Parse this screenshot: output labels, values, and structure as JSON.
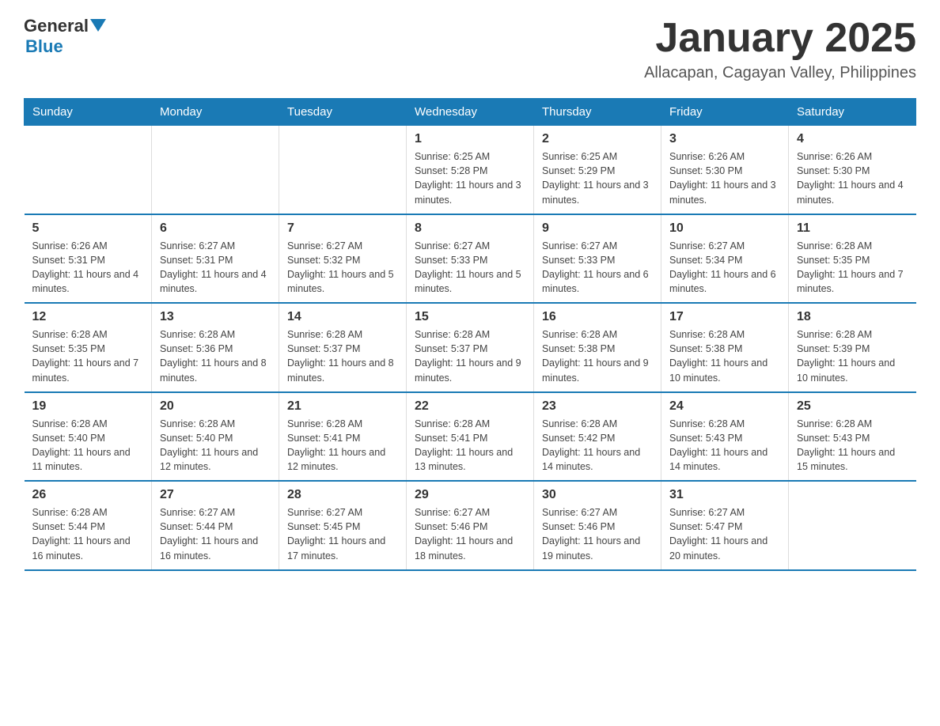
{
  "header": {
    "logo_general": "General",
    "logo_blue": "Blue",
    "month_title": "January 2025",
    "location": "Allacapan, Cagayan Valley, Philippines"
  },
  "weekdays": [
    "Sunday",
    "Monday",
    "Tuesday",
    "Wednesday",
    "Thursday",
    "Friday",
    "Saturday"
  ],
  "weeks": [
    [
      {
        "day": "",
        "info": ""
      },
      {
        "day": "",
        "info": ""
      },
      {
        "day": "",
        "info": ""
      },
      {
        "day": "1",
        "info": "Sunrise: 6:25 AM\nSunset: 5:28 PM\nDaylight: 11 hours and 3 minutes."
      },
      {
        "day": "2",
        "info": "Sunrise: 6:25 AM\nSunset: 5:29 PM\nDaylight: 11 hours and 3 minutes."
      },
      {
        "day": "3",
        "info": "Sunrise: 6:26 AM\nSunset: 5:30 PM\nDaylight: 11 hours and 3 minutes."
      },
      {
        "day": "4",
        "info": "Sunrise: 6:26 AM\nSunset: 5:30 PM\nDaylight: 11 hours and 4 minutes."
      }
    ],
    [
      {
        "day": "5",
        "info": "Sunrise: 6:26 AM\nSunset: 5:31 PM\nDaylight: 11 hours and 4 minutes."
      },
      {
        "day": "6",
        "info": "Sunrise: 6:27 AM\nSunset: 5:31 PM\nDaylight: 11 hours and 4 minutes."
      },
      {
        "day": "7",
        "info": "Sunrise: 6:27 AM\nSunset: 5:32 PM\nDaylight: 11 hours and 5 minutes."
      },
      {
        "day": "8",
        "info": "Sunrise: 6:27 AM\nSunset: 5:33 PM\nDaylight: 11 hours and 5 minutes."
      },
      {
        "day": "9",
        "info": "Sunrise: 6:27 AM\nSunset: 5:33 PM\nDaylight: 11 hours and 6 minutes."
      },
      {
        "day": "10",
        "info": "Sunrise: 6:27 AM\nSunset: 5:34 PM\nDaylight: 11 hours and 6 minutes."
      },
      {
        "day": "11",
        "info": "Sunrise: 6:28 AM\nSunset: 5:35 PM\nDaylight: 11 hours and 7 minutes."
      }
    ],
    [
      {
        "day": "12",
        "info": "Sunrise: 6:28 AM\nSunset: 5:35 PM\nDaylight: 11 hours and 7 minutes."
      },
      {
        "day": "13",
        "info": "Sunrise: 6:28 AM\nSunset: 5:36 PM\nDaylight: 11 hours and 8 minutes."
      },
      {
        "day": "14",
        "info": "Sunrise: 6:28 AM\nSunset: 5:37 PM\nDaylight: 11 hours and 8 minutes."
      },
      {
        "day": "15",
        "info": "Sunrise: 6:28 AM\nSunset: 5:37 PM\nDaylight: 11 hours and 9 minutes."
      },
      {
        "day": "16",
        "info": "Sunrise: 6:28 AM\nSunset: 5:38 PM\nDaylight: 11 hours and 9 minutes."
      },
      {
        "day": "17",
        "info": "Sunrise: 6:28 AM\nSunset: 5:38 PM\nDaylight: 11 hours and 10 minutes."
      },
      {
        "day": "18",
        "info": "Sunrise: 6:28 AM\nSunset: 5:39 PM\nDaylight: 11 hours and 10 minutes."
      }
    ],
    [
      {
        "day": "19",
        "info": "Sunrise: 6:28 AM\nSunset: 5:40 PM\nDaylight: 11 hours and 11 minutes."
      },
      {
        "day": "20",
        "info": "Sunrise: 6:28 AM\nSunset: 5:40 PM\nDaylight: 11 hours and 12 minutes."
      },
      {
        "day": "21",
        "info": "Sunrise: 6:28 AM\nSunset: 5:41 PM\nDaylight: 11 hours and 12 minutes."
      },
      {
        "day": "22",
        "info": "Sunrise: 6:28 AM\nSunset: 5:41 PM\nDaylight: 11 hours and 13 minutes."
      },
      {
        "day": "23",
        "info": "Sunrise: 6:28 AM\nSunset: 5:42 PM\nDaylight: 11 hours and 14 minutes."
      },
      {
        "day": "24",
        "info": "Sunrise: 6:28 AM\nSunset: 5:43 PM\nDaylight: 11 hours and 14 minutes."
      },
      {
        "day": "25",
        "info": "Sunrise: 6:28 AM\nSunset: 5:43 PM\nDaylight: 11 hours and 15 minutes."
      }
    ],
    [
      {
        "day": "26",
        "info": "Sunrise: 6:28 AM\nSunset: 5:44 PM\nDaylight: 11 hours and 16 minutes."
      },
      {
        "day": "27",
        "info": "Sunrise: 6:27 AM\nSunset: 5:44 PM\nDaylight: 11 hours and 16 minutes."
      },
      {
        "day": "28",
        "info": "Sunrise: 6:27 AM\nSunset: 5:45 PM\nDaylight: 11 hours and 17 minutes."
      },
      {
        "day": "29",
        "info": "Sunrise: 6:27 AM\nSunset: 5:46 PM\nDaylight: 11 hours and 18 minutes."
      },
      {
        "day": "30",
        "info": "Sunrise: 6:27 AM\nSunset: 5:46 PM\nDaylight: 11 hours and 19 minutes."
      },
      {
        "day": "31",
        "info": "Sunrise: 6:27 AM\nSunset: 5:47 PM\nDaylight: 11 hours and 20 minutes."
      },
      {
        "day": "",
        "info": ""
      }
    ]
  ]
}
